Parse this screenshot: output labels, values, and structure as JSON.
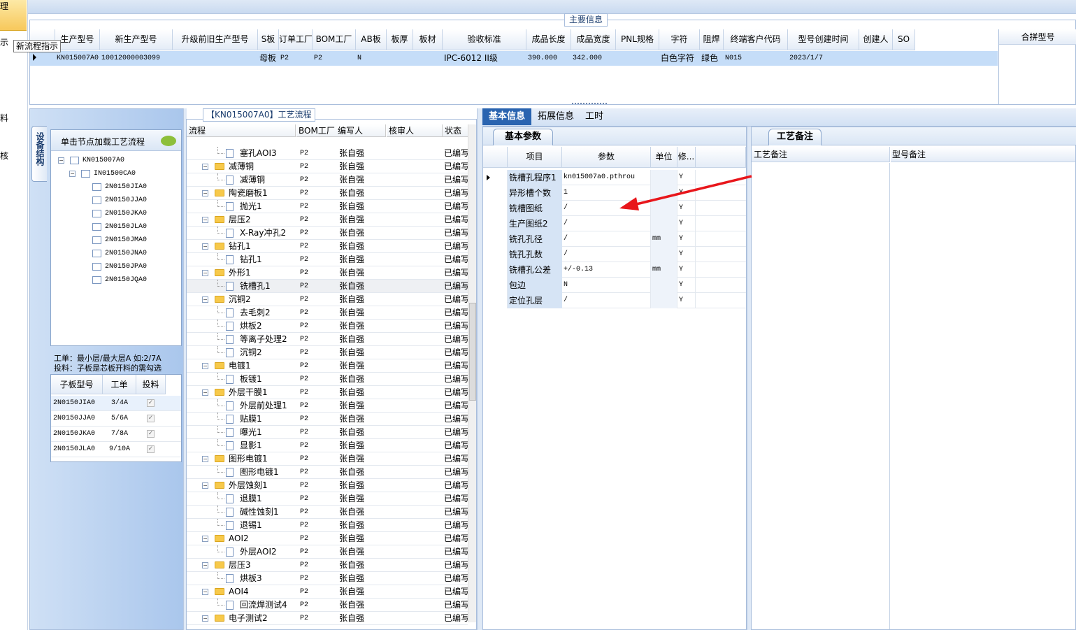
{
  "left_nav": {
    "top_label": "理",
    "tooltip": "新流程指示",
    "items": [
      "示",
      "料",
      "核"
    ]
  },
  "main_info": {
    "title": "主要信息",
    "columns": [
      "生产型号",
      "新生产型号",
      "升级前旧生产型号",
      "S板",
      "订单工厂",
      "BOM工厂",
      "AB板",
      "板厚",
      "板材",
      "验收标准",
      "成品长度",
      "成品宽度",
      "PNL规格",
      "字符",
      "阻焊",
      "终端客户代码",
      "型号创建时间",
      "创建人",
      "SO"
    ],
    "row": [
      "KN015007A0",
      "10012000003099",
      "",
      "母板",
      "P2",
      "P2",
      "N",
      "",
      "",
      "IPC-6012 II级",
      "390.000",
      "342.000",
      "",
      "白色字符",
      "绿色",
      "N015",
      "2023/1/7",
      "",
      ""
    ],
    "merge_header": "合拼型号"
  },
  "left_panel": {
    "vertical_tab": "设备结构",
    "header": "单击节点加载工艺流程",
    "tree": [
      "KN015007A0",
      "IN01500CA0",
      "2N0150JIA0",
      "2N0150JJA0",
      "2N0150JKA0",
      "2N0150JLA0",
      "2N0150JMA0",
      "2N0150JNA0",
      "2N0150JPA0",
      "2N0150JQA0"
    ],
    "note1": "工单：最小层/最大层A 如:2/7A",
    "note2": "投料：子板是芯板开料的需勾选",
    "sub_columns": [
      "子板型号",
      "工单",
      "投料"
    ],
    "sub_rows": [
      [
        "2N0150JIA0",
        "3/4A"
      ],
      [
        "2N0150JJA0",
        "5/6A"
      ],
      [
        "2N0150JKA0",
        "7/8A"
      ],
      [
        "2N0150JLA0",
        "9/10A"
      ]
    ]
  },
  "process": {
    "title": "【KN015007A0】工艺流程",
    "columns": [
      "流程",
      "BOM工厂",
      "编写人",
      "核审人",
      "状态"
    ],
    "rows": [
      {
        "level": 2,
        "name": "塞孔AOI3",
        "bom": "P2",
        "author": "张自强",
        "status": "已编写"
      },
      {
        "level": 1,
        "name": "减薄铜",
        "bom": "P2",
        "author": "张自强",
        "status": "已编写"
      },
      {
        "level": 2,
        "name": "减薄铜",
        "bom": "P2",
        "author": "张自强",
        "status": "已编写"
      },
      {
        "level": 1,
        "name": "陶瓷磨板1",
        "bom": "P2",
        "author": "张自强",
        "status": "已编写"
      },
      {
        "level": 2,
        "name": "抛光1",
        "bom": "P2",
        "author": "张自强",
        "status": "已编写"
      },
      {
        "level": 1,
        "name": "层压2",
        "bom": "P2",
        "author": "张自强",
        "status": "已编写"
      },
      {
        "level": 2,
        "name": "X-Ray冲孔2",
        "bom": "P2",
        "author": "张自强",
        "status": "已编写"
      },
      {
        "level": 1,
        "name": "钻孔1",
        "bom": "P2",
        "author": "张自强",
        "status": "已编写"
      },
      {
        "level": 2,
        "name": "钻孔1",
        "bom": "P2",
        "author": "张自强",
        "status": "已编写"
      },
      {
        "level": 1,
        "name": "外形1",
        "bom": "P2",
        "author": "张自强",
        "status": "已编写"
      },
      {
        "level": 2,
        "name": "铣槽孔1",
        "bom": "P2",
        "author": "张自强",
        "status": "已编写"
      },
      {
        "level": 1,
        "name": "沉铜2",
        "bom": "P2",
        "author": "张自强",
        "status": "已编写"
      },
      {
        "level": 2,
        "name": "去毛刺2",
        "bom": "P2",
        "author": "张自强",
        "status": "已编写"
      },
      {
        "level": 2,
        "name": "烘板2",
        "bom": "P2",
        "author": "张自强",
        "status": "已编写"
      },
      {
        "level": 2,
        "name": "等离子处理2",
        "bom": "P2",
        "author": "张自强",
        "status": "已编写"
      },
      {
        "level": 2,
        "name": "沉铜2",
        "bom": "P2",
        "author": "张自强",
        "status": "已编写"
      },
      {
        "level": 1,
        "name": "电镀1",
        "bom": "P2",
        "author": "张自强",
        "status": "已编写"
      },
      {
        "level": 2,
        "name": "板镀1",
        "bom": "P2",
        "author": "张自强",
        "status": "已编写"
      },
      {
        "level": 1,
        "name": "外层干膜1",
        "bom": "P2",
        "author": "张自强",
        "status": "已编写"
      },
      {
        "level": 2,
        "name": "外层前处理1",
        "bom": "P2",
        "author": "张自强",
        "status": "已编写"
      },
      {
        "level": 2,
        "name": "贴膜1",
        "bom": "P2",
        "author": "张自强",
        "status": "已编写"
      },
      {
        "level": 2,
        "name": "曝光1",
        "bom": "P2",
        "author": "张自强",
        "status": "已编写"
      },
      {
        "level": 2,
        "name": "显影1",
        "bom": "P2",
        "author": "张自强",
        "status": "已编写"
      },
      {
        "level": 1,
        "name": "图形电镀1",
        "bom": "P2",
        "author": "张自强",
        "status": "已编写"
      },
      {
        "level": 2,
        "name": "图形电镀1",
        "bom": "P2",
        "author": "张自强",
        "status": "已编写"
      },
      {
        "level": 1,
        "name": "外层蚀刻1",
        "bom": "P2",
        "author": "张自强",
        "status": "已编写"
      },
      {
        "level": 2,
        "name": "退膜1",
        "bom": "P2",
        "author": "张自强",
        "status": "已编写"
      },
      {
        "level": 2,
        "name": "碱性蚀刻1",
        "bom": "P2",
        "author": "张自强",
        "status": "已编写"
      },
      {
        "level": 2,
        "name": "退锡1",
        "bom": "P2",
        "author": "张自强",
        "status": "已编写"
      },
      {
        "level": 1,
        "name": "AOI2",
        "bom": "P2",
        "author": "张自强",
        "status": "已编写"
      },
      {
        "level": 2,
        "name": "外层AOI2",
        "bom": "P2",
        "author": "张自强",
        "status": "已编写"
      },
      {
        "level": 1,
        "name": "层压3",
        "bom": "P2",
        "author": "张自强",
        "status": "已编写"
      },
      {
        "level": 2,
        "name": "烘板3",
        "bom": "P2",
        "author": "张自强",
        "status": "已编写"
      },
      {
        "level": 1,
        "name": "AOI4",
        "bom": "P2",
        "author": "张自强",
        "status": "已编写"
      },
      {
        "level": 2,
        "name": "回流焊测试4",
        "bom": "P2",
        "author": "张自强",
        "status": "已编写"
      },
      {
        "level": 1,
        "name": "电子测试2",
        "bom": "P2",
        "author": "张自强",
        "status": "已编写"
      }
    ]
  },
  "detail": {
    "tabs": [
      "基本信息",
      "拓展信息",
      "工时"
    ],
    "subtab": "基本参数",
    "columns": [
      "项目",
      "参数",
      "单位",
      "修..."
    ],
    "rows": [
      [
        "铣槽孔程序1",
        "kn015007a0.pthrou",
        "",
        "Y"
      ],
      [
        "异形槽个数",
        "1",
        "",
        "Y"
      ],
      [
        "铣槽图纸",
        "/",
        "",
        "Y"
      ],
      [
        "生产图纸2",
        "/",
        "",
        "Y"
      ],
      [
        "铣孔孔径",
        "/",
        "mm",
        "Y"
      ],
      [
        "铣孔孔数",
        "/",
        "",
        "Y"
      ],
      [
        "铣槽孔公差",
        "+/-0.13",
        "mm",
        "Y"
      ],
      [
        "包边",
        "N",
        "",
        "Y"
      ],
      [
        "定位孔层",
        "/",
        "",
        "Y"
      ]
    ]
  },
  "remarks": {
    "tab": "工艺备注",
    "col1": "工艺备注",
    "col2": "型号备注"
  }
}
